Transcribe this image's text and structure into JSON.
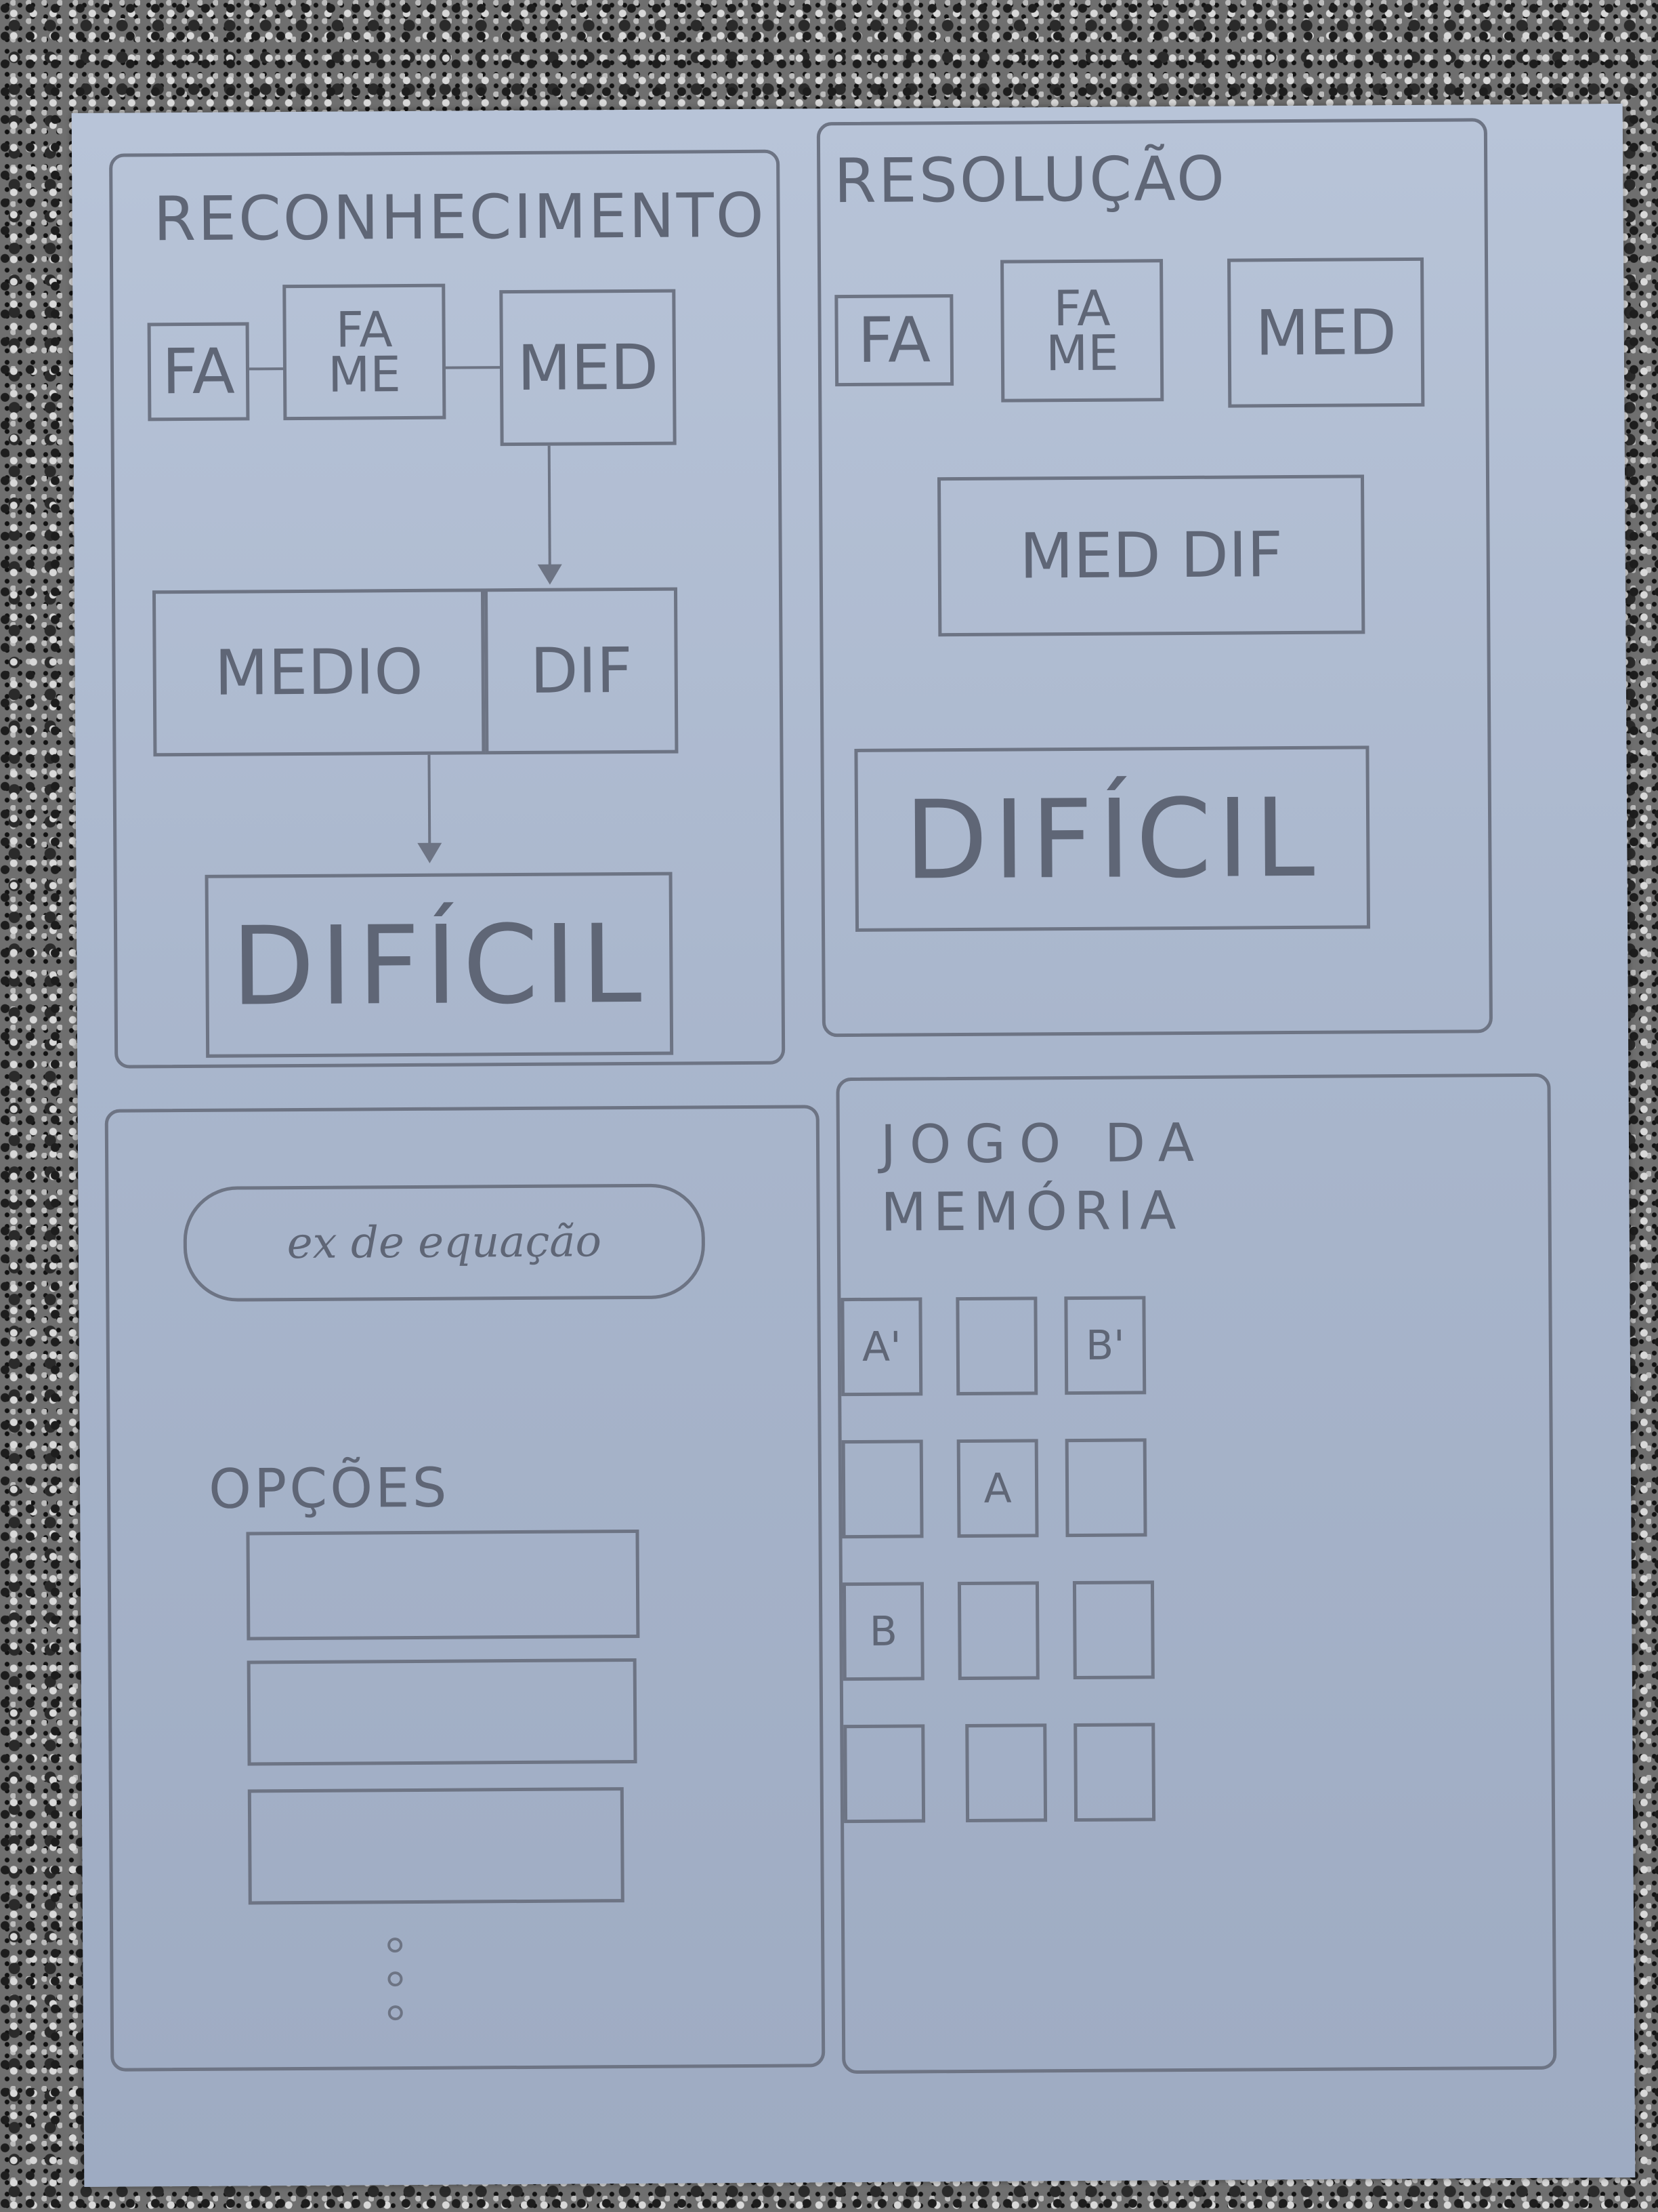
{
  "reconhecimento": {
    "title": "RECONHECIMENTO",
    "levels": {
      "fa": "FA",
      "fame": "FA\nME",
      "med": "MED",
      "medio": "MEDIO",
      "dif": "DIF",
      "dificil": "DIFÍCIL"
    }
  },
  "resolucao": {
    "title": "RESOLUÇÃO",
    "levels": {
      "fa": "FA",
      "fame": "FA\nME",
      "med": "MED",
      "med_dif": "MED DIF",
      "dificil": "DIFÍCIL"
    }
  },
  "equacao": {
    "example": "ex de equação",
    "options_label": "OPÇÕES",
    "options": [
      "",
      "",
      ""
    ]
  },
  "jogo": {
    "title_line1": "JOGO DA",
    "title_line2": "MEMÓRIA",
    "cards": [
      "A'",
      "",
      "B'",
      "",
      "A",
      "",
      "B",
      "",
      "",
      "",
      "",
      ""
    ]
  }
}
